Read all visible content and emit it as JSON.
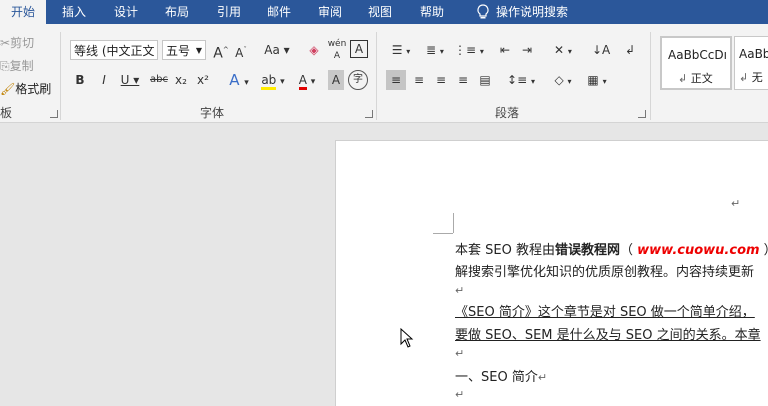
{
  "tabs": [
    "开始",
    "插入",
    "设计",
    "布局",
    "引用",
    "邮件",
    "审阅",
    "视图",
    "帮助",
    "操作说明搜索"
  ],
  "clipboard": {
    "cut": "剪切",
    "copy": "复制",
    "format_painter": "格式刷",
    "label": "板"
  },
  "font": {
    "name": "等线 (中文正文",
    "size": "五号",
    "label": "字体",
    "case": "Aa",
    "phonetic": "wén",
    "bold": "B",
    "italic": "I",
    "underline": "U",
    "strike": "abc",
    "sub": "x₂",
    "sup": "x²",
    "font_color": "A",
    "char_shade": "A",
    "enclose": "字",
    "grow": "A",
    "shrink": "A",
    "effects": "A",
    "border_char": "A"
  },
  "paragraph": {
    "label": "段落"
  },
  "styles": {
    "sample1": "AaBbCcDı",
    "name1": "正文",
    "sample2": "AaBb",
    "name2": "无"
  },
  "doc": {
    "l1_a": "本套 SEO 教程由",
    "l1_b": "错误教程网",
    "l1_c": "（  ",
    "l1_d": "www.cuowu.com",
    "l1_e": " ）",
    "l2": "解搜索引擎优化知识的优质原创教程。内容持续更新",
    "l3": "《SEO 简介》这个章节是对 SEO 做一个简单介绍，",
    "l4": "要做 SEO、SEM 是什么及与 SEO 之间的关系。本章",
    "l5": "一、SEO 简介",
    "pilcrow": "↵"
  },
  "colors": {
    "accent": "#2b579a",
    "link_red": "#e00000"
  }
}
